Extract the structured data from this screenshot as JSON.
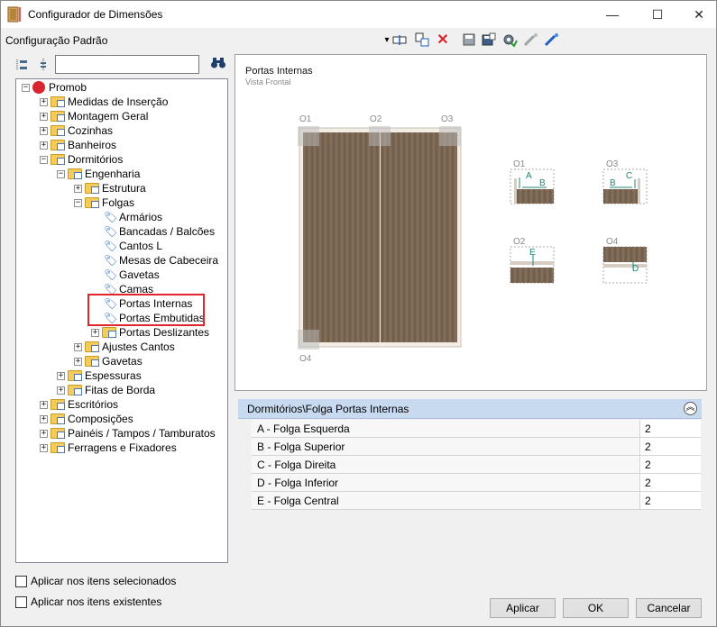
{
  "window": {
    "title": "Configurador de Dimensões",
    "minimize": "—",
    "maximize": "☐",
    "close": "✕"
  },
  "toolbar": {
    "config_label": "Configuração Padrão",
    "dropdown_arrow": "▾"
  },
  "tree": {
    "root": "Promob",
    "nodes": [
      {
        "label": "Medidas de Inserção",
        "level": 1,
        "expander": "+"
      },
      {
        "label": "Montagem Geral",
        "level": 1,
        "expander": "+"
      },
      {
        "label": "Cozinhas",
        "level": 1,
        "expander": "+"
      },
      {
        "label": "Banheiros",
        "level": 1,
        "expander": "+"
      },
      {
        "label": "Dormitórios",
        "level": 1,
        "expander": "−"
      },
      {
        "label": "Engenharia",
        "level": 2,
        "expander": "−"
      },
      {
        "label": "Estrutura",
        "level": 3,
        "expander": "+"
      },
      {
        "label": "Folgas",
        "level": 3,
        "expander": "−"
      },
      {
        "label": "Armários",
        "level": 4,
        "expander": ""
      },
      {
        "label": "Bancadas / Balcões",
        "level": 4,
        "expander": ""
      },
      {
        "label": "Cantos L",
        "level": 4,
        "expander": ""
      },
      {
        "label": "Mesas de Cabeceira",
        "level": 4,
        "expander": ""
      },
      {
        "label": "Gavetas",
        "level": 4,
        "expander": ""
      },
      {
        "label": "Camas",
        "level": 4,
        "expander": ""
      },
      {
        "label": "Portas Internas",
        "level": 4,
        "expander": ""
      },
      {
        "label": "Portas Embutidas",
        "level": 4,
        "expander": ""
      },
      {
        "label": "Portas Deslizantes",
        "level": 4,
        "expander": "+"
      },
      {
        "label": "Ajustes Cantos",
        "level": 3,
        "expander": "+"
      },
      {
        "label": "Gavetas",
        "level": 3,
        "expander": "+"
      },
      {
        "label": "Espessuras",
        "level": 2,
        "expander": "+"
      },
      {
        "label": "Fitas de Borda",
        "level": 2,
        "expander": "+"
      },
      {
        "label": "Escritórios",
        "level": 1,
        "expander": "+"
      },
      {
        "label": "Composições",
        "level": 1,
        "expander": "+"
      },
      {
        "label": "Painéis / Tampos / Tamburatos",
        "level": 1,
        "expander": "+"
      },
      {
        "label": "Ferragens e Fixadores",
        "level": 1,
        "expander": "+"
      }
    ]
  },
  "preview": {
    "title": "Portas Internas",
    "subtitle": "Vista Frontal",
    "labels": {
      "o1": "O1",
      "o2": "O2",
      "o3": "O3",
      "o4": "O4"
    },
    "detail_letters": {
      "a": "A",
      "b": "B",
      "c": "C",
      "d": "D",
      "e": "E"
    }
  },
  "properties": {
    "header": "Dormitórios\\Folga Portas Internas",
    "collapse": "︽",
    "rows": [
      {
        "name": "A - Folga Esquerda",
        "value": "2"
      },
      {
        "name": "B - Folga Superior",
        "value": "2"
      },
      {
        "name": "C - Folga Direita",
        "value": "2"
      },
      {
        "name": "D - Folga Inferior",
        "value": "2"
      },
      {
        "name": "E - Folga Central",
        "value": "2"
      }
    ]
  },
  "options": {
    "apply_selected": "Aplicar nos itens selecionados",
    "apply_existing": "Aplicar nos itens existentes"
  },
  "buttons": {
    "apply": "Aplicar",
    "ok": "OK",
    "cancel": "Cancelar"
  }
}
